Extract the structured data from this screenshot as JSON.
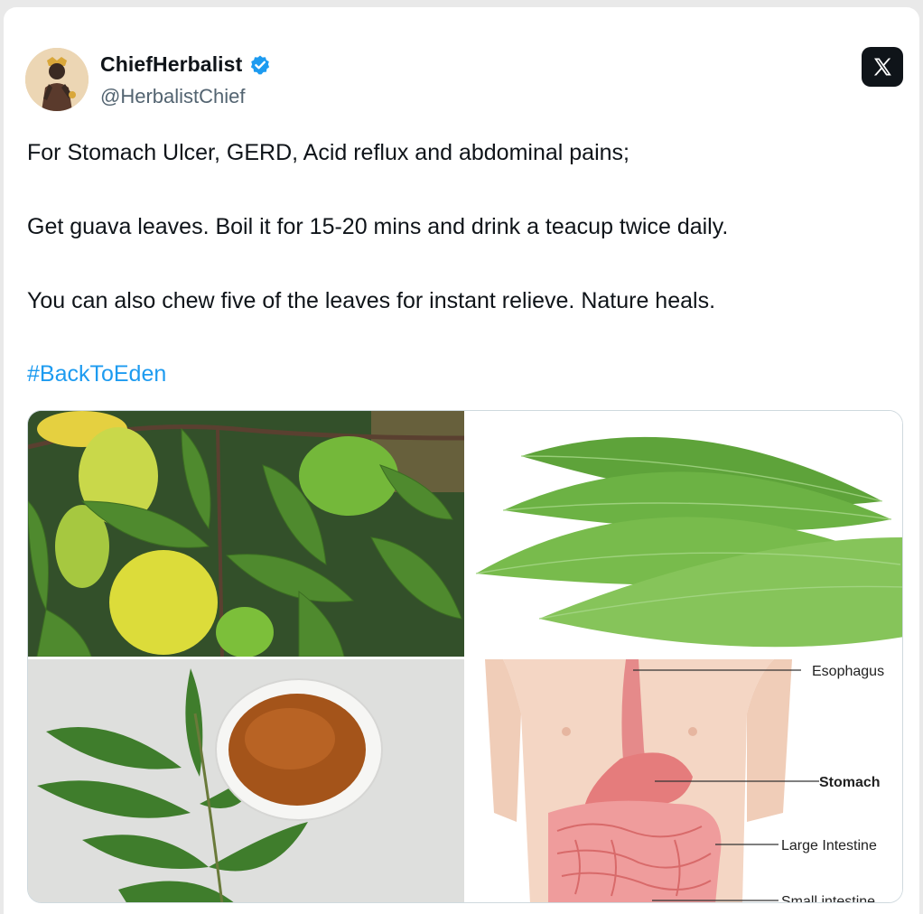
{
  "author": {
    "name": "ChiefHerbalist",
    "handle": "@HerbalistChief",
    "verified": true
  },
  "platform_icon": "x-logo-icon",
  "post": {
    "line1": "For Stomach Ulcer, GERD, Acid reflux and abdominal pains;",
    "line2": "Get guava leaves. Boil it for 15-20 mins and drink a teacup twice daily.",
    "line3": "You can also chew five of the leaves for instant relieve. Nature heals.",
    "hashtag": "#BackToEden"
  },
  "media": {
    "anatomy_labels": {
      "esophagus": "Esophagus",
      "stomach": "Stomach",
      "large_intestine": "Large Intestine",
      "small_intestine": "Small intestine"
    }
  },
  "colors": {
    "link": "#1d9bf0",
    "verified": "#1d9bf0",
    "text": "#0f1419",
    "secondary": "#536471"
  }
}
